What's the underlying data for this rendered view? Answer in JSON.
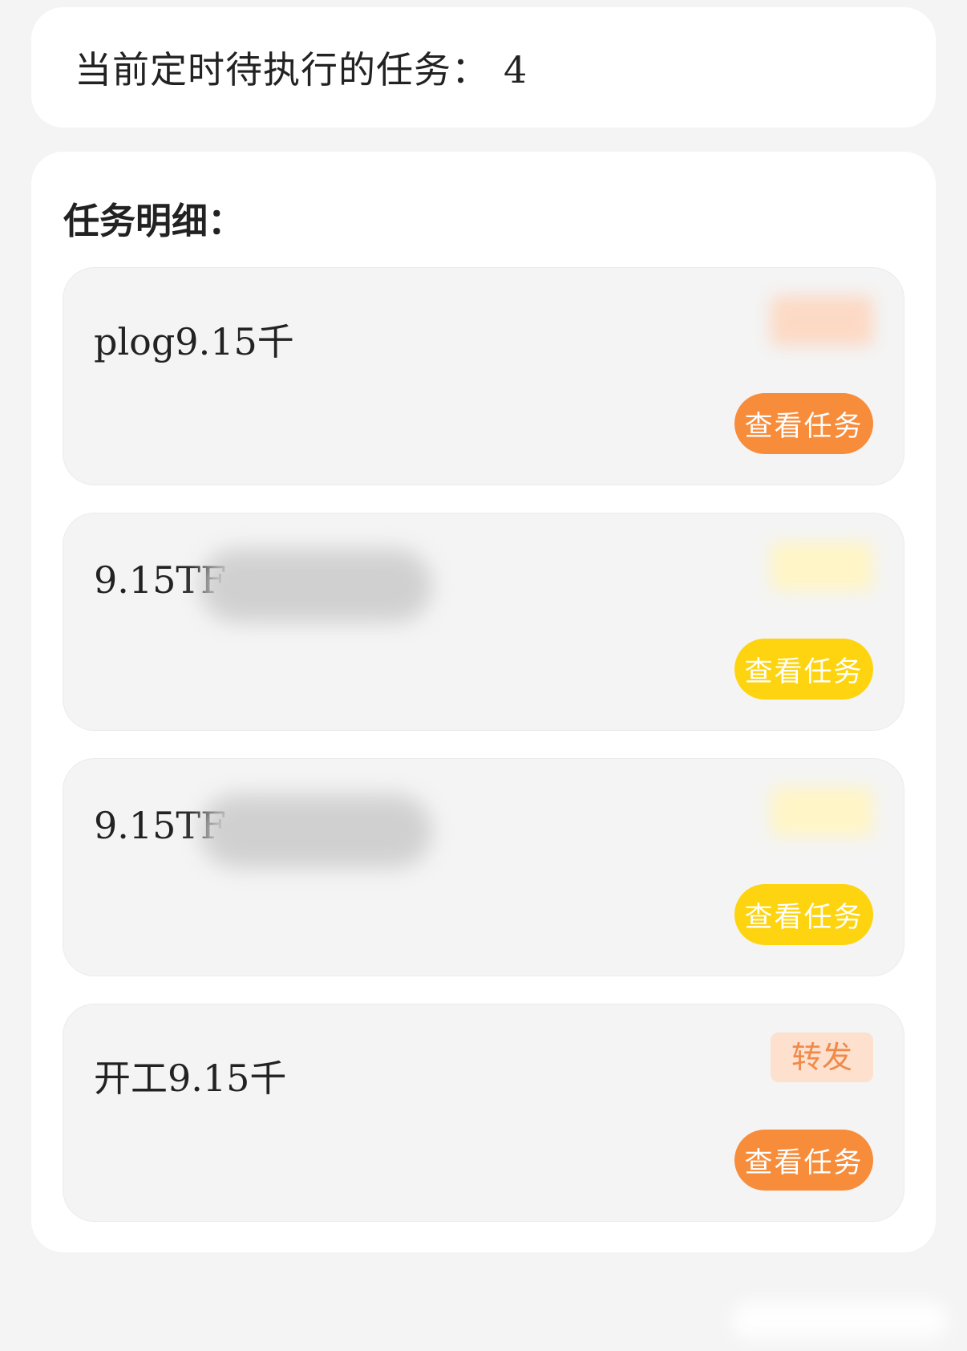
{
  "summary": {
    "label": "当前定时待执行的任务：",
    "count": "4"
  },
  "details": {
    "title": "任务明细："
  },
  "tasks": [
    {
      "name": "plog9.15千",
      "name_redacted": false,
      "tag": "",
      "tag_blurred": true,
      "tag_bg": "#fcd9c4",
      "tag_color": "#f08a4b",
      "button_label": "查看任务",
      "button_color": "#f78c3b"
    },
    {
      "name": "9.15TF",
      "name_redacted": true,
      "tag": "",
      "tag_blurred": true,
      "tag_bg": "#fff5c6",
      "tag_color": "#f5c400",
      "button_label": "查看任务",
      "button_color": "#fdd40f"
    },
    {
      "name": "9.15TF",
      "name_redacted": true,
      "tag": "",
      "tag_blurred": true,
      "tag_bg": "#fff5c6",
      "tag_color": "#f5c400",
      "button_label": "查看任务",
      "button_color": "#fdd40f"
    },
    {
      "name": "开工9.15千",
      "name_redacted": false,
      "tag": "转发",
      "tag_blurred": false,
      "tag_bg": "#fde0cd",
      "tag_color": "#f08a4b",
      "button_label": "查看任务",
      "button_color": "#f78c3b"
    }
  ]
}
